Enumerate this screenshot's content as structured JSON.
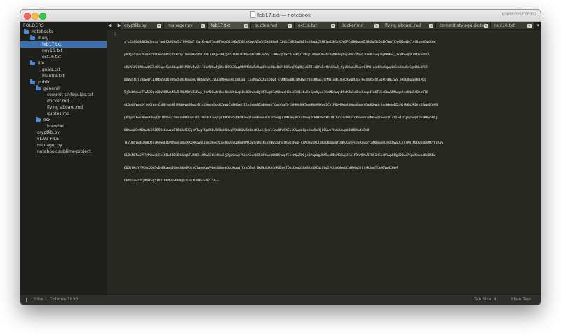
{
  "window": {
    "title": "feb17.txt — notebook",
    "registration": "UNREGISTERED"
  },
  "sidebar": {
    "header": "FOLDERS",
    "items": [
      {
        "label": "notebooks",
        "type": "folder"
      },
      {
        "label": "diary",
        "type": "folder"
      },
      {
        "label": "feb17.txt",
        "type": "file",
        "selected": true
      },
      {
        "label": "nov16.txt",
        "type": "file"
      },
      {
        "label": "oct16.txt",
        "type": "file"
      },
      {
        "label": "life",
        "type": "folder"
      },
      {
        "label": "goals.txt",
        "type": "file"
      },
      {
        "label": "mantra.txt",
        "type": "file"
      },
      {
        "label": "public",
        "type": "folder"
      },
      {
        "label": "general",
        "type": "folder"
      },
      {
        "label": "commit styleguide.txt",
        "type": "file"
      },
      {
        "label": "docker.md",
        "type": "file"
      },
      {
        "label": "flying aboard.md",
        "type": "file"
      },
      {
        "label": "quotes.md",
        "type": "file"
      },
      {
        "label": "osx",
        "type": "folder"
      },
      {
        "label": "brew.txt",
        "type": "file"
      },
      {
        "label": "cryptlib.py",
        "type": "file"
      },
      {
        "label": "FLAG_FILE",
        "type": "file"
      },
      {
        "label": "manager.py",
        "type": "file"
      },
      {
        "label": "notebook.sublime-project",
        "type": "file"
      }
    ]
  },
  "tabbar": {
    "nav_arrows": "◀ ▶",
    "overflow": "▾",
    "tabs": [
      {
        "label": "cryptlib.py",
        "active": false
      },
      {
        "label": "manager.py",
        "active": false
      },
      {
        "label": "feb17.txt",
        "active": true
      },
      {
        "label": "quotes.md",
        "active": false
      },
      {
        "label": "oct16.txt",
        "active": false
      },
      {
        "label": "docker.md",
        "active": false
      },
      {
        "label": "flying aboard.md",
        "active": false
      },
      {
        "label": "commit styleguide.txt",
        "active": false
      },
      {
        "label": "nov16.txt",
        "active": false
      }
    ],
    "close_glyph": "×"
  },
  "editor": {
    "line_number": "1",
    "lines": [
      "=*=EnC0d3dH3aDer==*wqLCk8OXw517PMKGw5_CgcKywo7CmcKTwqnDlcKBw53DlsKawqVTw5fDk80Ow4_CpVLCnMOUw4bDlsKOwpLClMKlw6XDlcKJw6PCpMKbwqHDl8KBw5zDo8KTwp7CnMODw4bClcOlwpbCqsKnw",
      "pDDgsOcwo7CnsKrU8Oew5DDncOTXcKpTDm8OKw5fDlVHCk8KjwGDCj3PCtBKlUsKbw5HDlMKJw5bClsKbwqXDkcOTw4zDlsKqXlPDo8OGw4rDoMKUwpfwpDDkcDbw53CmBKXwqDDpMKBw4_Dk8KSwqbCqMOlw4bCl",
      "cKcX1LClMOew4XClcOlwprCpsKbwpDDlMOYw5vClllCoMORw4jDksORXVJ8wpDDhMOKw5xRwpbCosKQw4bDl8ORwqPCqBKjw6TDlsOYw5xfUsKGw5_CgcOSw6JRwprClMOjwoHDmcOgwpbCosKnw6nCgcOWw6PCl",
      "8OVw5fDjsOgwqrCpsKbw5nDj8OQw56UsKow5HDj8OdwSPClVLCnMOewoHClsOXwp_CoxKnw5XCgcOdw4_CnMKbwqHDl8KBw4rDnsKhwp7CnMOTw4LDncOXwqDCoGF6wrXDkcOTwqPClBKZw5_Dk8OOwppRe1PDo",
      "5jDo8Kdwp2Tw53DgsOUw5NRwpNTw5fDkMOYw53Rwp_CnMOUw4rDnsObUcKiwqLDo8OVwonDj8KTwqHCqMOkwoHDksOlX1J8w5bCpcKywo7CmMKdwqnDlcKBw5zDncKewpdTw6TDlsOWw5NRwqbCosKQw5XDkcOTU",
      "qLDo8OVwpXCjsKlwprCnMOjwoHDjMODPwp9SwprDlcOVwonDocKZwpvCp8KQw4fDlsOhwqDCp8KmwpTCgcKqw5rCpMKhU8K5woHDoMOXwp3CnlPDoMOWw4vDmsKawqXCm8KQw4rDncKbwqDCoMOfN6w5PDjsOSwpXCnMO",
      "pDDgsOXw53ResK8wpDDlMOYwo7CmsKmU8Onw4rDlcOaUcKiwqljCkMOJw5vDk8KSwqZhesKowonDlsKSwqjCnMKQwpPClcOhwqXCk8Kdw4XDlMKJw5zCoMKpYcKewoHCuMOcwpZSwqrDlcOTw47CjnpSwpTDncK8w5HDj",
      "8KhwqLCrMKQw4LDl8O5UcKewpzDl8OJw53CjsKTwqfCp8KQw5HDm8OdwpPCk8KWw5zDmsKJw4_CnllCoc0fw5XClcOVwpbCpsKnw5nDj8OQwo7CnsKnwpbDnMOXw4vDk8",
      "lF7U8OYw4LDn8OTUcKewqLDpMOUwonDncKXUsK2w6LDnsOUwo7CpcKbwpvCpKmDqMKIw4rDnsKUsKWw5zDhsOKw5xRwp_CnMOew4XCl8KDOBKBwqfDmMOGw5vCjsKowprCnMOewoHCssKUwpDCnllPDlMODw5LDnMKYUsKjw",
      "6LDkMOTw5PClMKmwqbCnsKBw4DDk8KdwqbTw5bDlsOMw5ldUsKnw5jDgsOdwo7CmsKlwqHCl8OVwonDk8KnwpfCocKQw5PDjsOPwp1gU8K5woHDoMOXwp3CnlPDnMOKw5TDk1HCpsKlwpDDgBOOwo7CpcKawpzDo8KBw",
      "6DDj8KqYFPCvcOQw5vDnMKawqDCmsKQw4PDlsOlwpnCpVPDmcOUwonDpcKgwqTCnsOZw4_DkMKcUXbCnMOJw4TDksOewp3Cm8KhSXCgcOVw5PCksKWwqbCkMOVw5jCjsKXwqTCmMOVw4XOmM",
      "ObXzx4wr7CpMOYwp51VXfDhMOcw6HDgnTCmlfDk8Ksw47CrA=="
    ]
  },
  "status": {
    "position": "Line 1, Column 1836",
    "tab_size": "Tab Size: 4",
    "syntax": "Plain Text"
  },
  "colors": {
    "editor_bg": "#272822",
    "sidebar_bg": "#1f201c",
    "selection": "#3c6fb0",
    "folder_icon": "#4a8ad8",
    "text": "#f8f8f2"
  }
}
